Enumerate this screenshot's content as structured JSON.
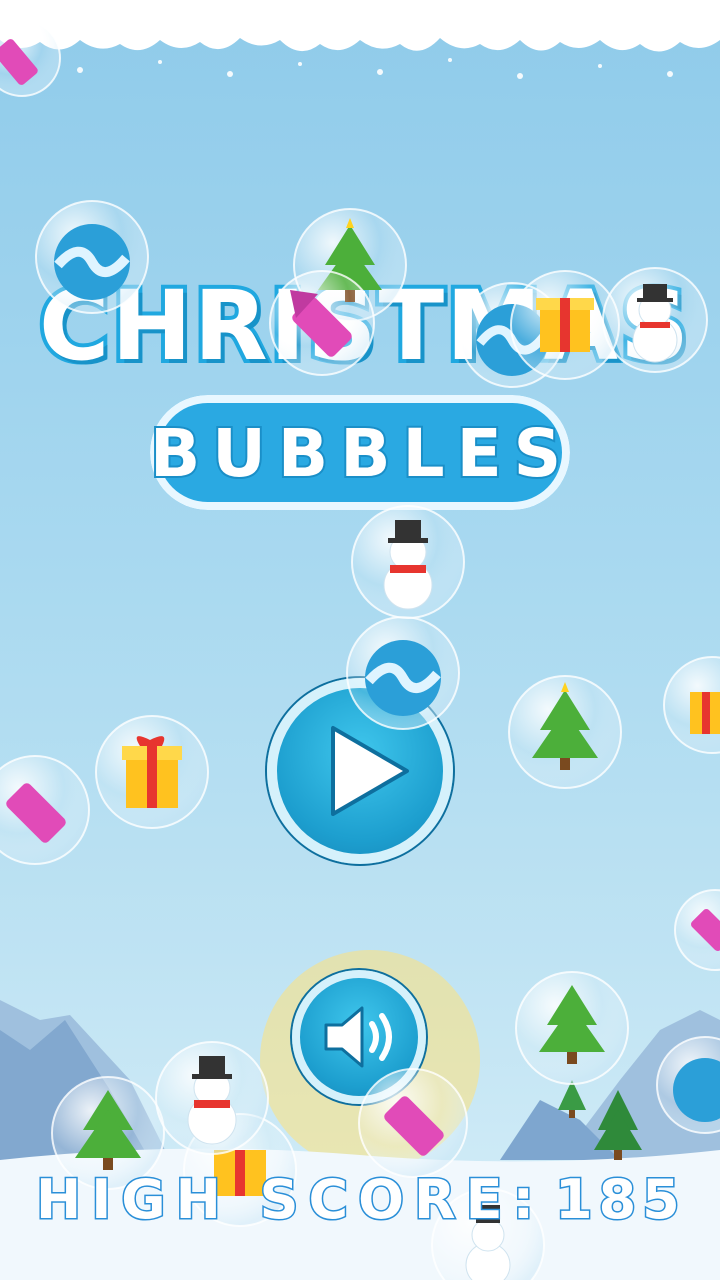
{
  "game": {
    "title_line1": "CHRISTMAS",
    "title_line2": "BUBBLES",
    "play_button_icon": "play-triangle-icon",
    "sound_button_icon": "speaker-sound-icon",
    "high_score_label": "HIGH SCORE:",
    "high_score_value": "185"
  },
  "colors": {
    "sky_top": "#8fcbea",
    "title_stroke": "#20a8e0",
    "button_blue": "#1d9fcf",
    "highscore_stroke": "#2a8fd8"
  },
  "bubble_icons": [
    "ornament-icon",
    "christmas-tree-icon",
    "firework-rocket-icon",
    "gift-box-icon",
    "snowman-icon"
  ]
}
